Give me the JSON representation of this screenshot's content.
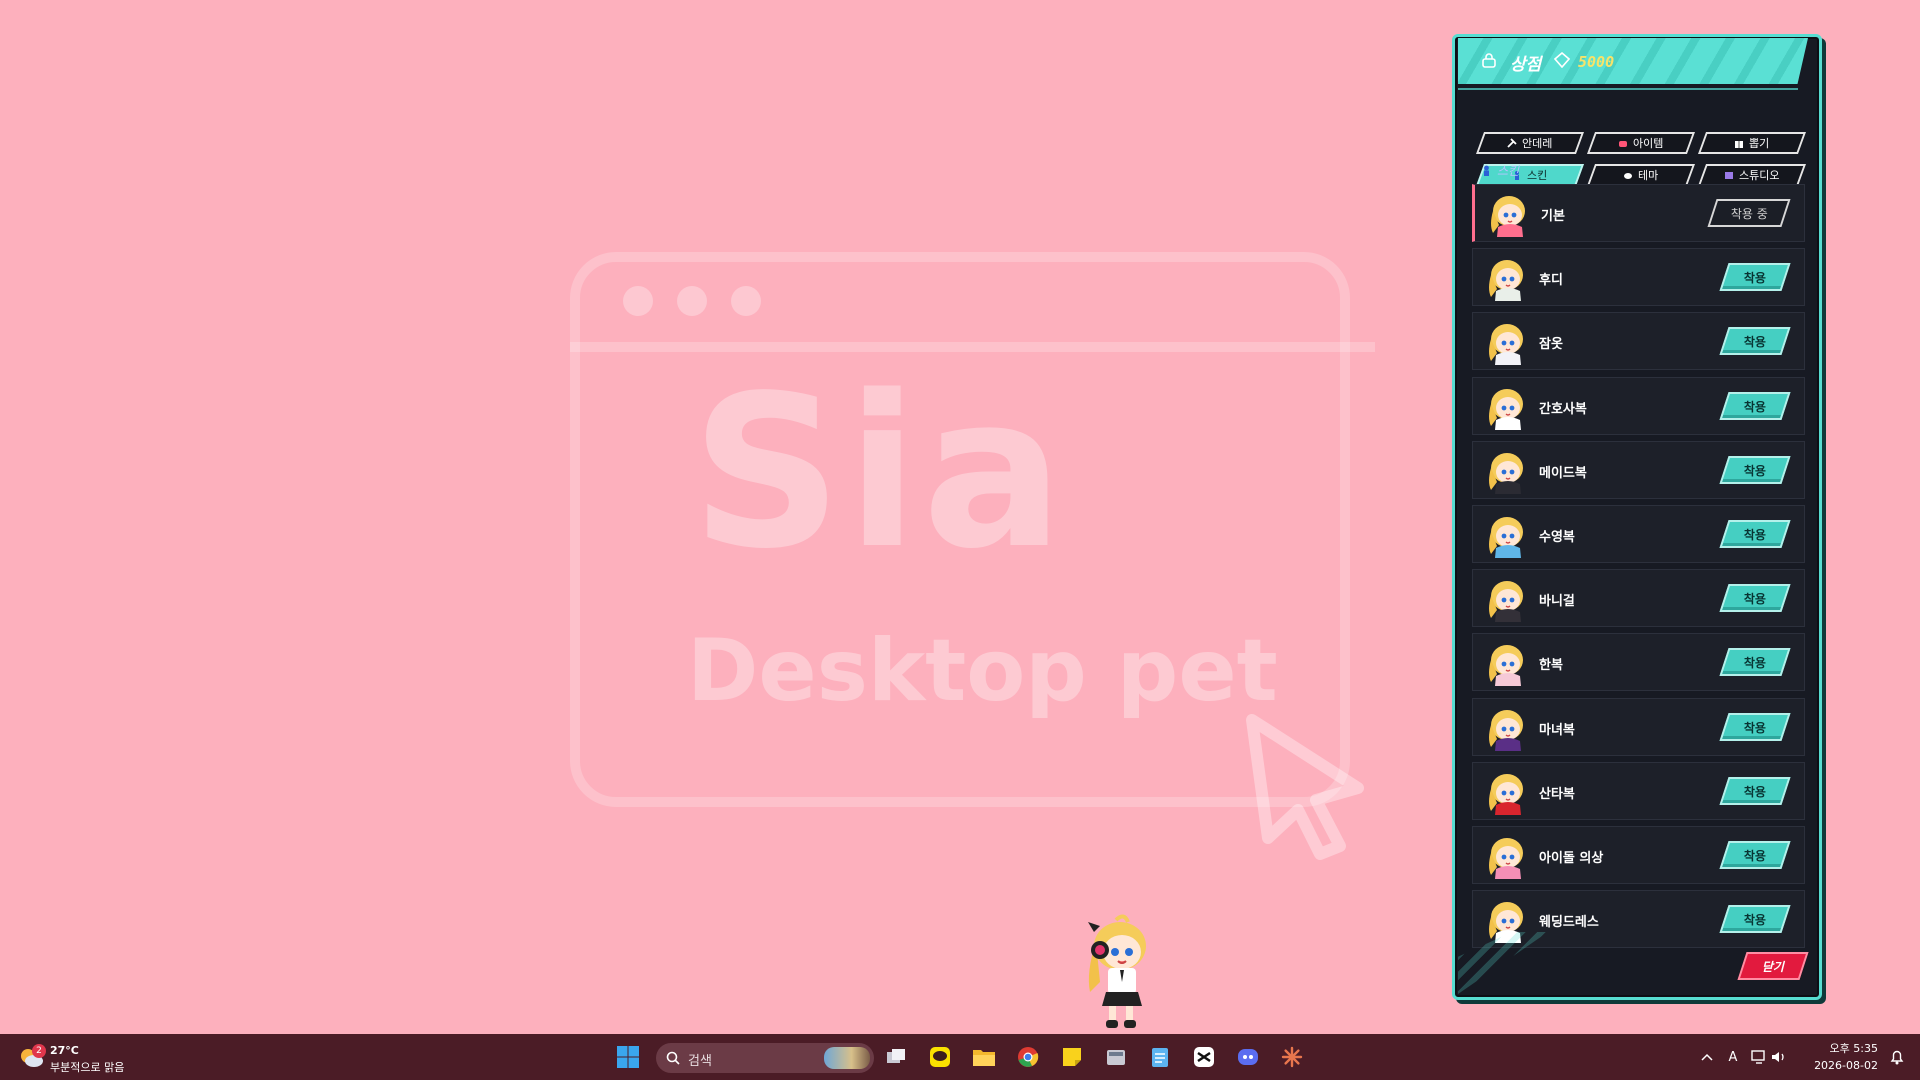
{
  "wallpaper": {
    "title": "Sia",
    "subtitle": "Desktop pet"
  },
  "shop": {
    "title": "상점",
    "points": "5000",
    "tabs": [
      {
        "label": "안데레",
        "icon": "pickaxe-icon",
        "active": false
      },
      {
        "label": "아이템",
        "icon": "bag-icon",
        "active": false
      },
      {
        "label": "뽑기",
        "icon": "gift-icon",
        "active": false
      },
      {
        "label": "스킨",
        "icon": "figure-icon",
        "active": true
      },
      {
        "label": "테마",
        "icon": "cloud-icon",
        "active": false
      },
      {
        "label": "스튜디오",
        "icon": "film-icon",
        "active": false
      }
    ],
    "section_label": "스킨",
    "equipped_label": "착용 중",
    "apply_label": "착용",
    "close_label": "닫기",
    "skins": [
      {
        "name": "기본",
        "equipped": true,
        "outfit": "#ff6f8e"
      },
      {
        "name": "후디",
        "equipped": false,
        "outfit": "#e9efe9"
      },
      {
        "name": "잠옷",
        "equipped": false,
        "outfit": "#f2f2f7"
      },
      {
        "name": "간호사복",
        "equipped": false,
        "outfit": "#ffffff"
      },
      {
        "name": "메이드복",
        "equipped": false,
        "outfit": "#2b2b33"
      },
      {
        "name": "수영복",
        "equipped": false,
        "outfit": "#5fb6e8"
      },
      {
        "name": "바니걸",
        "equipped": false,
        "outfit": "#333038"
      },
      {
        "name": "한복",
        "equipped": false,
        "outfit": "#f6c9d6"
      },
      {
        "name": "마녀복",
        "equipped": false,
        "outfit": "#5a2f86"
      },
      {
        "name": "산타복",
        "equipped": false,
        "outfit": "#d9252e"
      },
      {
        "name": "아이돌 의상",
        "equipped": false,
        "outfit": "#f58fb6"
      },
      {
        "name": "웨딩드레스",
        "equipped": false,
        "outfit": "#ffffff"
      }
    ]
  },
  "taskbar": {
    "weather_temp": "27°C",
    "weather_desc": "부분적으로 맑음",
    "weather_badge": "2",
    "search_placeholder": "검색",
    "time": "오후 5:35",
    "date": "2026-08-02",
    "ime_label": "A"
  }
}
